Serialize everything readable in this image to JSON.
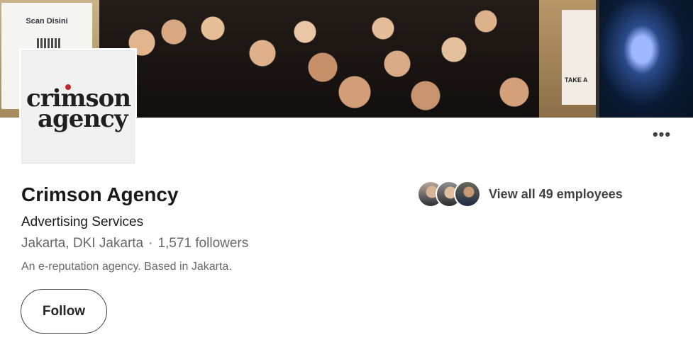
{
  "cover": {
    "banner_title": "Scan Disini",
    "poster_text": "TAKE A"
  },
  "logo": {
    "line1": "crimson",
    "line2": "agency",
    "accent_color": "#c0262d"
  },
  "menu": {
    "more_label": "•••"
  },
  "company": {
    "name": "Crimson Agency",
    "industry": "Advertising Services",
    "location": "Jakarta, DKI Jakarta",
    "separator": "·",
    "followers": "1,571 followers",
    "tagline": "An e-reputation agency. Based in Jakarta."
  },
  "actions": {
    "follow_label": "Follow"
  },
  "employees": {
    "label": "View all 49 employees"
  }
}
